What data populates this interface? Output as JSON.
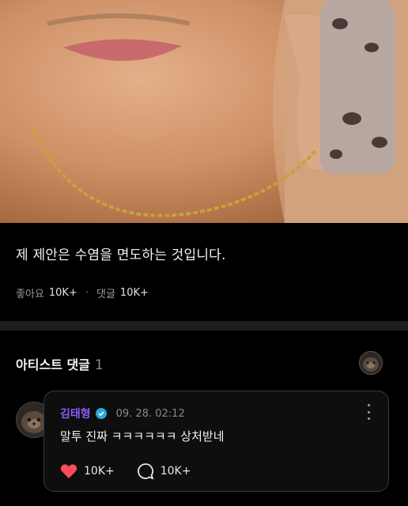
{
  "post": {
    "caption": "제 제안은 수염을 면도하는 것입니다.",
    "likes_label": "좋아요",
    "likes_count": "10K+",
    "comments_label": "댓글",
    "comments_count": "10K+"
  },
  "artist_comments": {
    "title": "아티스트 댓글",
    "count": "1"
  },
  "comment": {
    "author": "김태형",
    "time": "09. 28. 02:12",
    "text": "말투 진짜 ㅋㅋㅋㅋㅋㅋ 상처받네",
    "likes": "10K+",
    "replies": "10K+"
  },
  "colors": {
    "author": "#8d5cf6",
    "heart": "#ff4b5c",
    "verified": "#2aa8d8"
  },
  "icons": [
    "heart-icon",
    "comment-bubble-icon",
    "more-vertical-icon",
    "verified-badge-icon"
  ]
}
